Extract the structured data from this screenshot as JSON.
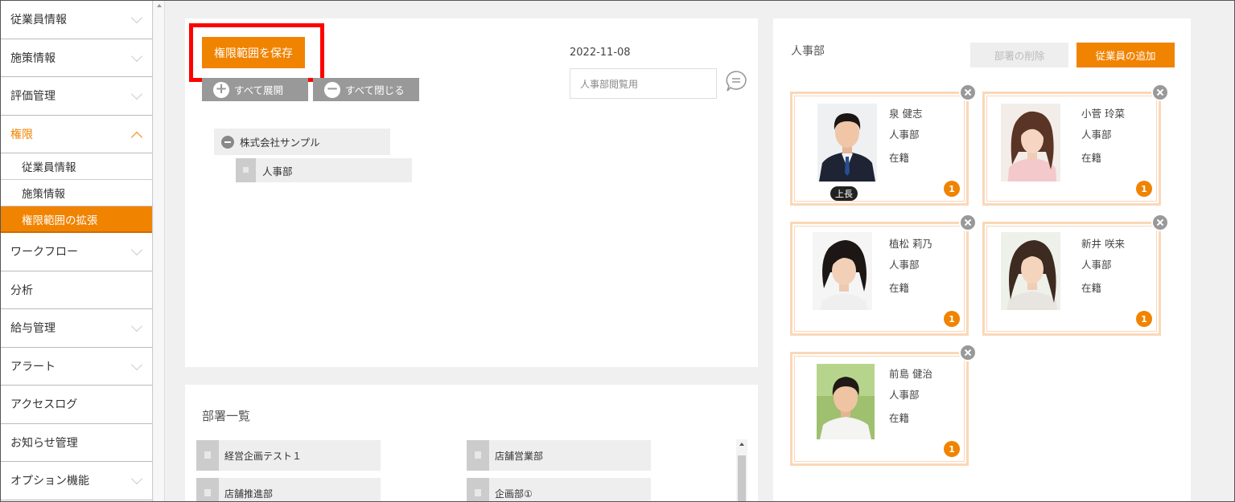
{
  "sidebar": {
    "items": [
      {
        "label": "従業員情報"
      },
      {
        "label": "施策情報"
      },
      {
        "label": "評価管理"
      },
      {
        "label": "権限"
      },
      {
        "label": "ワークフロー"
      },
      {
        "label": "分析"
      },
      {
        "label": "給与管理"
      },
      {
        "label": "アラート"
      },
      {
        "label": "アクセスログ"
      },
      {
        "label": "お知らせ管理"
      },
      {
        "label": "オプション機能"
      }
    ],
    "sub_items": [
      {
        "label": "従業員情報"
      },
      {
        "label": "施策情報"
      },
      {
        "label": "権限範囲の拡張"
      }
    ]
  },
  "toolbar": {
    "save_label": "権限範囲を保存",
    "expand_all_label": "すべて展開",
    "collapse_all_label": "すべて閉じる",
    "date": "2022-11-08",
    "comment_value": "人事部閲覧用"
  },
  "tree": {
    "root": "株式会社サンプル",
    "child": "人事部"
  },
  "dept_list": {
    "title": "部署一覧",
    "items": [
      "経営企画テスト１",
      "店舗営業部",
      "店舗推進部",
      "企画部①"
    ]
  },
  "right_panel": {
    "title": "人事部",
    "delete_label": "部署の削除",
    "add_label": "従業員の追加",
    "boss_label": "上長",
    "employees": [
      {
        "name": "泉 健志",
        "dept": "人事部",
        "status": "在籍",
        "badge": "1"
      },
      {
        "name": "小菅 玲菜",
        "dept": "人事部",
        "status": "在籍",
        "badge": "1"
      },
      {
        "name": "植松 莉乃",
        "dept": "人事部",
        "status": "在籍",
        "badge": "1"
      },
      {
        "name": "新井 咲来",
        "dept": "人事部",
        "status": "在籍",
        "badge": "1"
      },
      {
        "name": "前島 健治",
        "dept": "人事部",
        "status": "在籍",
        "badge": "1"
      }
    ]
  },
  "colors": {
    "accent": "#f08300",
    "highlight": "#ff0000",
    "card_border": "#fbd7b7"
  }
}
